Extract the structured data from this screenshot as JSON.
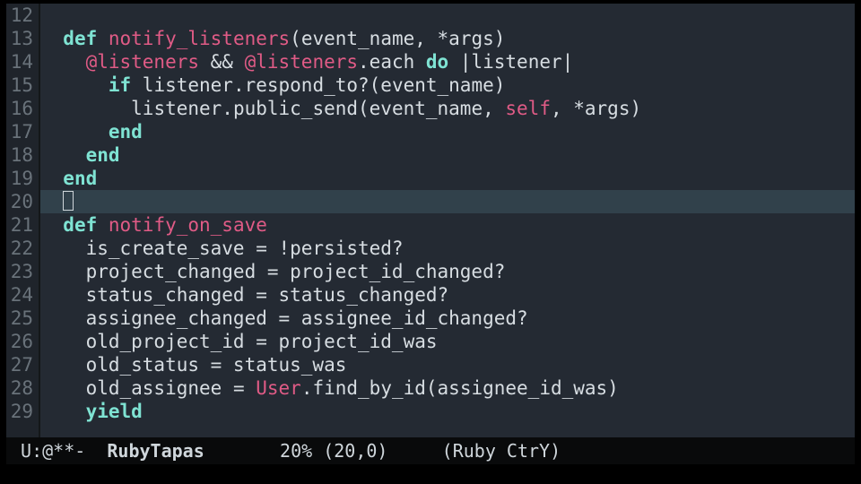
{
  "gutter": [
    "12",
    "13",
    "14",
    "15",
    "16",
    "17",
    "18",
    "19",
    "20",
    "21",
    "22",
    "23",
    "24",
    "25",
    "26",
    "27",
    "28",
    "29"
  ],
  "code": {
    "l12": "",
    "l13": {
      "indent": "  ",
      "def": "def ",
      "name": "notify_listeners",
      "rest": "(event_name, *args)"
    },
    "l14": {
      "indent": "    ",
      "ivar1": "@listeners",
      "amp": " && ",
      "ivar2": "@listeners",
      "call": ".each ",
      "do": "do",
      "blk": " |listener|"
    },
    "l15": {
      "indent": "      ",
      "if": "if ",
      "rest": "listener.respond_to?(event_name)"
    },
    "l16": {
      "indent": "        ",
      "a": "listener.public_send(event_name, ",
      "self": "self",
      "b": ", *args)"
    },
    "l17": {
      "indent": "      ",
      "end": "end"
    },
    "l18": {
      "indent": "    ",
      "end": "end"
    },
    "l19": {
      "indent": "  ",
      "end": "end"
    },
    "l20": {
      "indent": "  "
    },
    "l21": {
      "indent": "  ",
      "def": "def ",
      "name": "notify_on_save"
    },
    "l22": "    is_create_save = !persisted?",
    "l23": "    project_changed = project_id_changed?",
    "l24": "    status_changed = status_changed?",
    "l25": "    assignee_changed = assignee_id_changed?",
    "l26": "    old_project_id = project_id_was",
    "l27": "    old_status = status_was",
    "l28": {
      "indent": "    ",
      "a": "old_assignee = ",
      "const": "User",
      "b": ".find_by_id(assignee_id_was)"
    },
    "l29": {
      "indent": "    ",
      "yield": "yield"
    }
  },
  "modeline": {
    "left": " U:@**-  ",
    "buffer": "RubyTapas",
    "mid": "       20% (20,0)     (Ruby CtrY)"
  }
}
